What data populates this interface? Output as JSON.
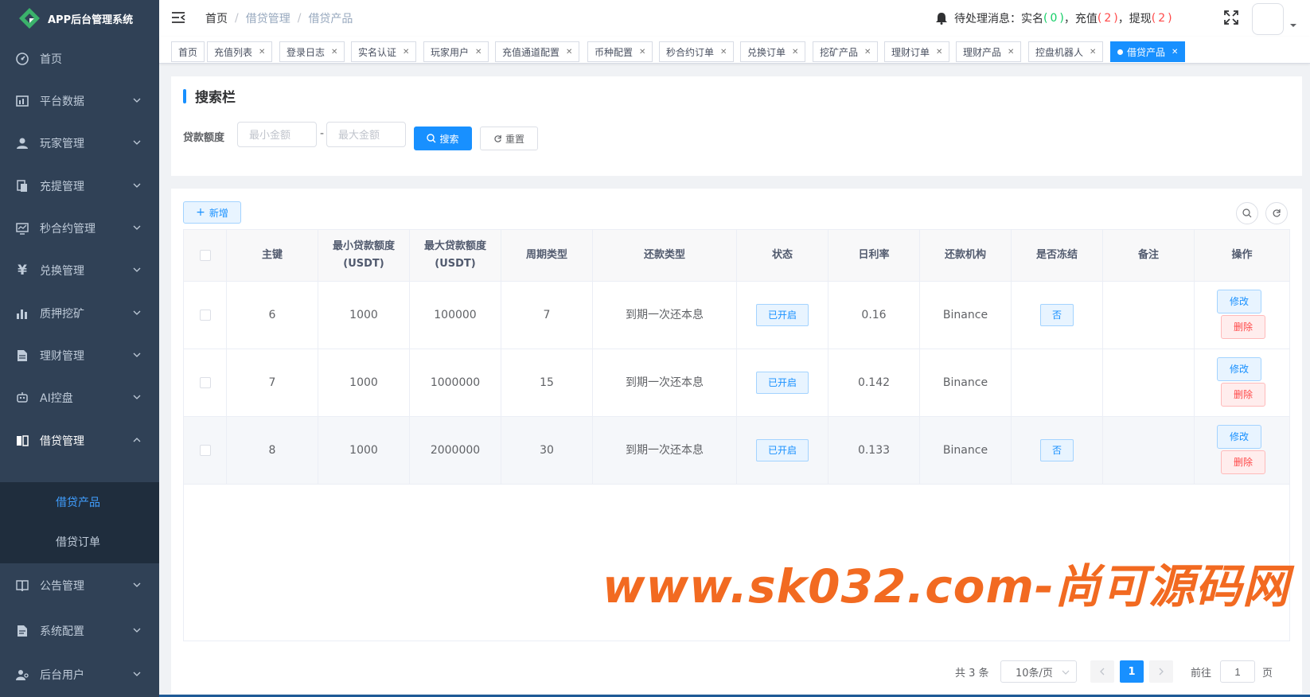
{
  "app": {
    "title": "APP后台管理系统"
  },
  "sidebar": {
    "items": [
      {
        "label": "首页",
        "icon": "dashboard-icon"
      },
      {
        "label": "平台数据",
        "icon": "chart-icon"
      },
      {
        "label": "玩家管理",
        "icon": "user-icon"
      },
      {
        "label": "充提管理",
        "icon": "transfer-icon"
      },
      {
        "label": "秒合约管理",
        "icon": "monitor-icon"
      },
      {
        "label": "兑换管理",
        "icon": "yen-icon"
      },
      {
        "label": "质押挖矿",
        "icon": "bar-chart-icon"
      },
      {
        "label": "理财管理",
        "icon": "document-icon"
      },
      {
        "label": "AI控盘",
        "icon": "robot-icon"
      },
      {
        "label": "借贷管理",
        "icon": "book-icon"
      },
      {
        "label": "公告管理",
        "icon": "notice-icon"
      },
      {
        "label": "系统配置",
        "icon": "settings-icon"
      },
      {
        "label": "后台用户",
        "icon": "admin-user-icon"
      }
    ],
    "submenu": [
      {
        "label": "借贷产品"
      },
      {
        "label": "借贷订单"
      }
    ]
  },
  "header": {
    "breadcrumb": [
      "首页",
      "借贷管理",
      "借贷产品"
    ],
    "notice": {
      "prefix": "待处理消息：",
      "realname_label": "实名",
      "realname_count": "0",
      "recharge_label": "充值",
      "recharge_count": "2",
      "withdraw_label": "提现",
      "withdraw_count": "2"
    }
  },
  "tags": [
    {
      "label": "首页"
    },
    {
      "label": "充值列表"
    },
    {
      "label": "登录日志"
    },
    {
      "label": "实名认证"
    },
    {
      "label": "玩家用户"
    },
    {
      "label": "充值通道配置"
    },
    {
      "label": "币种配置"
    },
    {
      "label": "秒合约订单"
    },
    {
      "label": "兑换订单"
    },
    {
      "label": "挖矿产品"
    },
    {
      "label": "理财订单"
    },
    {
      "label": "理财产品"
    },
    {
      "label": "控盘机器人"
    },
    {
      "label": "借贷产品"
    }
  ],
  "search": {
    "title": "搜索栏",
    "label": "贷款额度",
    "min_placeholder": "最小金额",
    "max_placeholder": "最大金额",
    "separator": "-",
    "search_label": "搜索",
    "reset_label": "重置"
  },
  "toolbar": {
    "add_label": "新增"
  },
  "table": {
    "headers": [
      "主键",
      "最小贷款额度(USDT)",
      "最大贷款额度(USDT)",
      "周期类型",
      "还款类型",
      "状态",
      "日利率",
      "还款机构",
      "是否冻结",
      "备注",
      "操作"
    ],
    "rows": [
      {
        "id": "6",
        "min": "1000",
        "max": "100000",
        "period": "7",
        "repay": "到期一次还本息",
        "status": "已开启",
        "rate": "0.16",
        "org": "Binance",
        "frozen": "否",
        "remark": ""
      },
      {
        "id": "7",
        "min": "1000",
        "max": "1000000",
        "period": "15",
        "repay": "到期一次还本息",
        "status": "已开启",
        "rate": "0.142",
        "org": "Binance",
        "frozen": "",
        "remark": ""
      },
      {
        "id": "8",
        "min": "1000",
        "max": "2000000",
        "period": "30",
        "repay": "到期一次还本息",
        "status": "已开启",
        "rate": "0.133",
        "org": "Binance",
        "frozen": "否",
        "remark": ""
      }
    ],
    "edit_label": "修改",
    "delete_label": "删除"
  },
  "pagination": {
    "total": "共 3 条",
    "page_size": "10条/页",
    "current": "1",
    "goto_prefix": "前往",
    "goto_value": "1",
    "goto_suffix": "页"
  },
  "watermark": "www.sk032.com-尚可源码网",
  "colors": {
    "sidebar_bg": "#304156",
    "accent": "#1890ff",
    "danger": "#ff4949",
    "success": "#13ce66",
    "watermark": "#f26a21"
  }
}
